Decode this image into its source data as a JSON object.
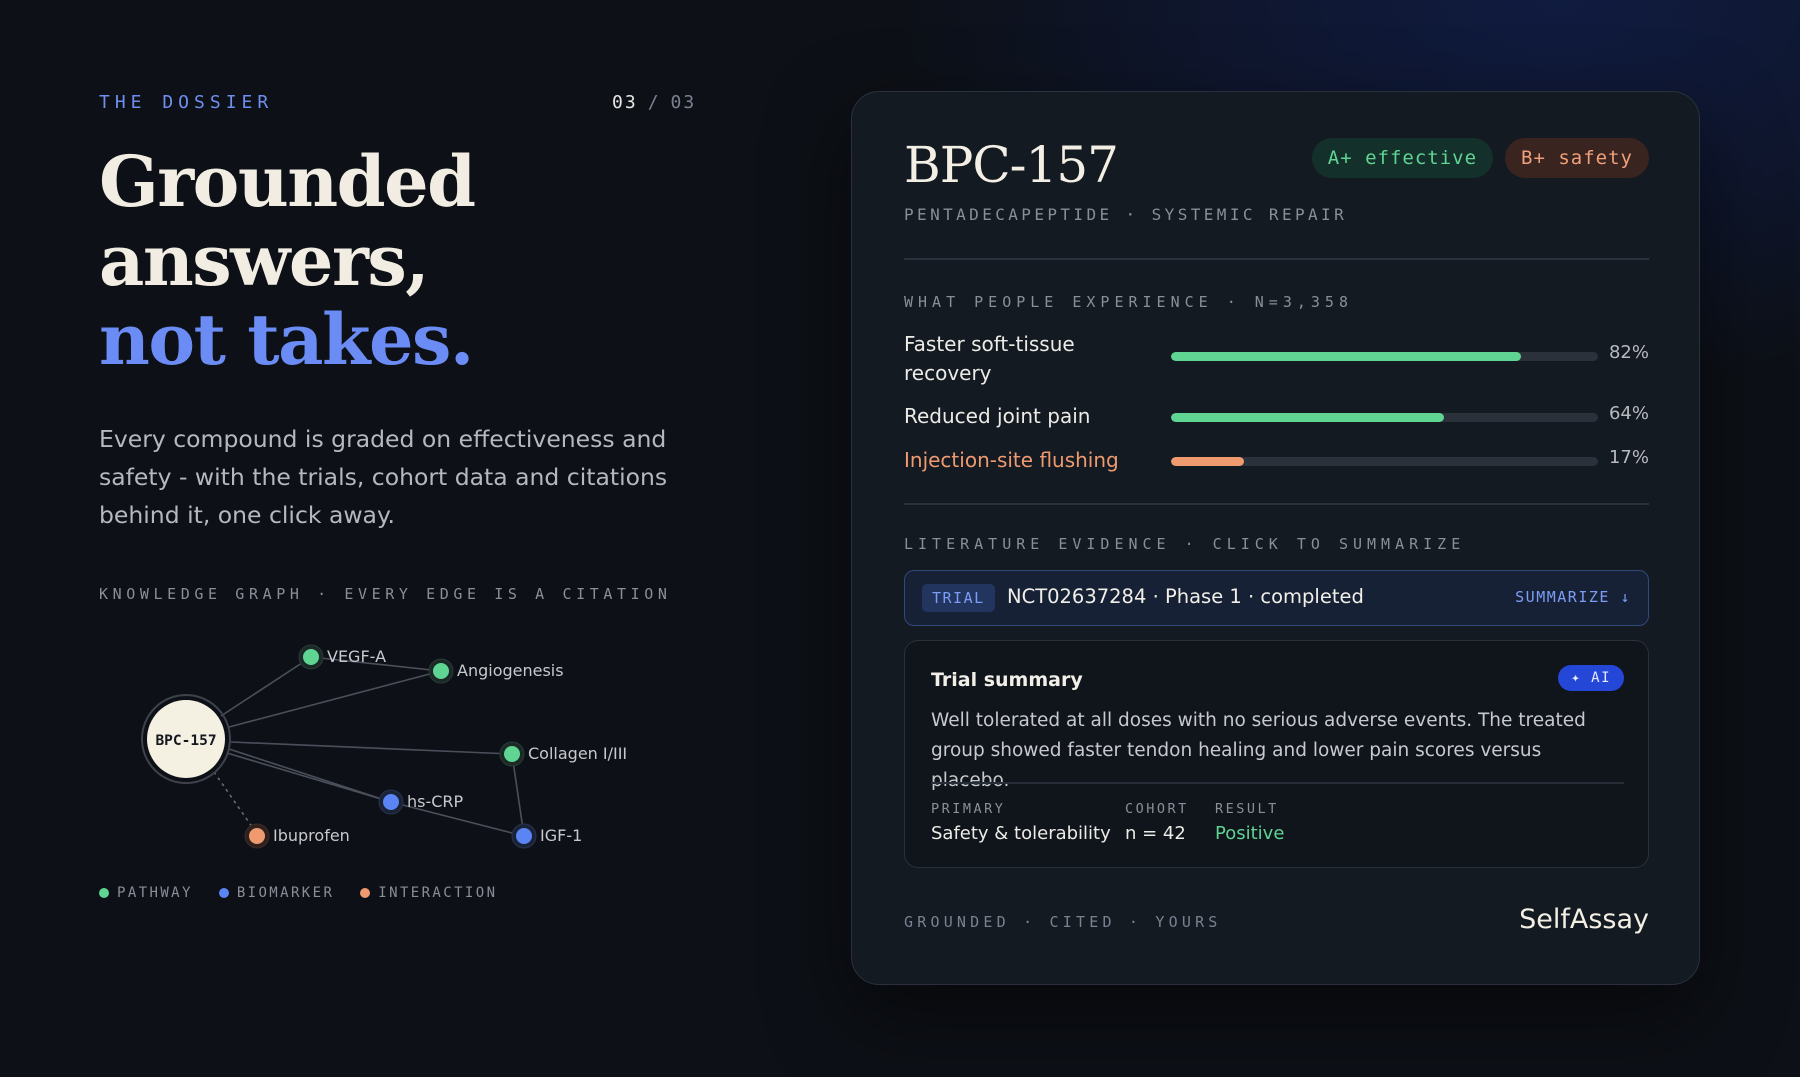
{
  "left": {
    "eyebrow": "THE DOSSIER",
    "pager": {
      "current": "03",
      "separator": "/",
      "total": "03"
    },
    "headline": {
      "line1": "Grounded",
      "line2": "answers,",
      "line3": "not takes."
    },
    "lede": "Every compound is graded on effectiveness and safety - with the trials, cohort data and citations behind it, one click away.",
    "graph_label": "KNOWLEDGE GRAPH · EVERY EDGE IS A CITATION",
    "graph": {
      "center": "BPC-157",
      "nodes": [
        {
          "label": "VEGF-A",
          "kind": "pathway"
        },
        {
          "label": "Angiogenesis",
          "kind": "pathway"
        },
        {
          "label": "Collagen I/III",
          "kind": "pathway"
        },
        {
          "label": "hs-CRP",
          "kind": "biomarker"
        },
        {
          "label": "IGF-1",
          "kind": "biomarker"
        },
        {
          "label": "Ibuprofen",
          "kind": "interaction"
        }
      ]
    },
    "legend": [
      {
        "label": "PATHWAY",
        "color": "#5fd493"
      },
      {
        "label": "BIOMARKER",
        "color": "#5b84f5"
      },
      {
        "label": "INTERACTION",
        "color": "#ef9a6f"
      }
    ],
    "colors": {
      "pathway": "#5fd493",
      "biomarker": "#5b84f5",
      "interaction": "#ef9a6f",
      "accent": "#6b8cf5"
    }
  },
  "card": {
    "title": "BPC-157",
    "badges": {
      "effective": "A+ effective",
      "safety": "B+ safety"
    },
    "subtitle": "PENTADECAPEPTIDE · SYSTEMIC REPAIR",
    "experience_label": "WHAT PEOPLE EXPERIENCE · N=3,358",
    "experiences": [
      {
        "label": "Faster soft-tissue recovery",
        "percent": 82,
        "pct_text": "82%",
        "color": "#5fd493"
      },
      {
        "label": "Reduced joint pain",
        "percent": 64,
        "pct_text": "64%",
        "color": "#5fd493"
      },
      {
        "label": "Injection-site flushing",
        "percent": 17,
        "pct_text": "17%",
        "color": "#ef9a6f"
      }
    ],
    "literature_label": "LITERATURE EVIDENCE · CLICK TO SUMMARIZE",
    "trial": {
      "tag": "TRIAL",
      "text": "NCT02637284 · Phase 1 · completed",
      "action": "SUMMARIZE ↓"
    },
    "summary": {
      "title": "Trial summary",
      "ai_badge": "✦ AI",
      "body": "Well tolerated at all doses with no serious adverse events. The treated group showed faster tendon healing and lower pain scores versus placebo.",
      "primary_label": "PRIMARY",
      "primary_value": "Safety & tolerability",
      "cohort_label": "COHORT",
      "cohort_value": "n = 42",
      "result_label": "RESULT",
      "result_value": "Positive"
    },
    "footer": "GROUNDED · CITED · YOURS",
    "brand": "SelfAssay"
  }
}
